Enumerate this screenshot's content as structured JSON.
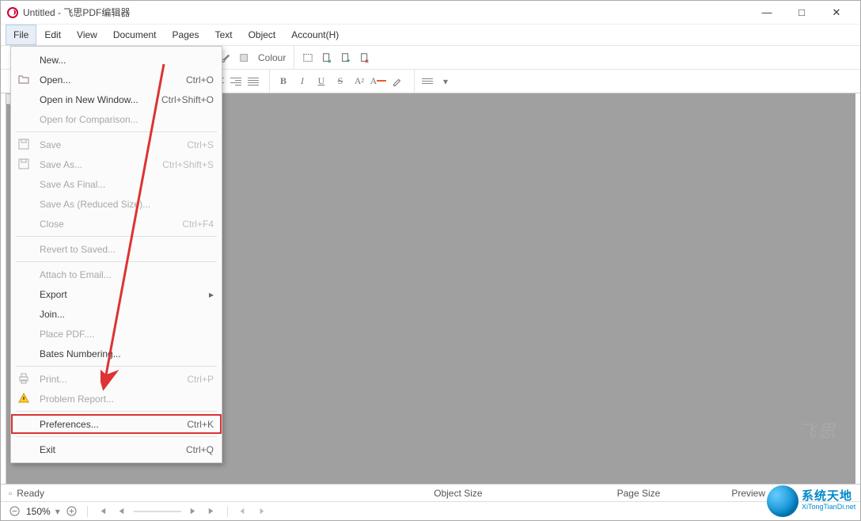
{
  "title": "Untitled - 飞思PDF编辑器",
  "window_controls": {
    "min": "—",
    "max": "□",
    "close": "✕"
  },
  "menubar": [
    "File",
    "Edit",
    "View",
    "Document",
    "Pages",
    "Text",
    "Object",
    "Account(H)"
  ],
  "menubar_active_index": 0,
  "toolbar2": {
    "colour_label": "Colour"
  },
  "file_menu": [
    {
      "type": "item",
      "label": "New...",
      "shortcut": "",
      "icon": "",
      "disabled": false
    },
    {
      "type": "item",
      "label": "Open...",
      "shortcut": "Ctrl+O",
      "icon": "folder",
      "disabled": false
    },
    {
      "type": "item",
      "label": "Open in New Window...",
      "shortcut": "Ctrl+Shift+O",
      "icon": "",
      "disabled": false
    },
    {
      "type": "item",
      "label": "Open for Comparison...",
      "shortcut": "",
      "icon": "",
      "disabled": true
    },
    {
      "type": "sep"
    },
    {
      "type": "item",
      "label": "Save",
      "shortcut": "Ctrl+S",
      "icon": "save",
      "disabled": true
    },
    {
      "type": "item",
      "label": "Save As...",
      "shortcut": "Ctrl+Shift+S",
      "icon": "save",
      "disabled": true
    },
    {
      "type": "item",
      "label": "Save As Final...",
      "shortcut": "",
      "icon": "",
      "disabled": true
    },
    {
      "type": "item",
      "label": "Save As (Reduced Size)...",
      "shortcut": "",
      "icon": "",
      "disabled": true
    },
    {
      "type": "item",
      "label": "Close",
      "shortcut": "Ctrl+F4",
      "icon": "",
      "disabled": true
    },
    {
      "type": "sep"
    },
    {
      "type": "item",
      "label": "Revert to Saved...",
      "shortcut": "",
      "icon": "",
      "disabled": true
    },
    {
      "type": "sep"
    },
    {
      "type": "item",
      "label": "Attach to Email...",
      "shortcut": "",
      "icon": "",
      "disabled": true
    },
    {
      "type": "item",
      "label": "Export",
      "shortcut": "",
      "icon": "",
      "disabled": false,
      "submenu": true
    },
    {
      "type": "item",
      "label": "Join...",
      "shortcut": "",
      "icon": "",
      "disabled": false
    },
    {
      "type": "item",
      "label": "Place PDF....",
      "shortcut": "",
      "icon": "",
      "disabled": true
    },
    {
      "type": "item",
      "label": "Bates Numbering...",
      "shortcut": "",
      "icon": "",
      "disabled": false
    },
    {
      "type": "sep"
    },
    {
      "type": "item",
      "label": "Print...",
      "shortcut": "Ctrl+P",
      "icon": "print",
      "disabled": true
    },
    {
      "type": "item",
      "label": "Problem Report...",
      "shortcut": "",
      "icon": "warn",
      "disabled": true
    },
    {
      "type": "sep"
    },
    {
      "type": "item",
      "label": "Preferences...",
      "shortcut": "Ctrl+K",
      "icon": "",
      "disabled": false,
      "highlight": true
    },
    {
      "type": "sep"
    },
    {
      "type": "item",
      "label": "Exit",
      "shortcut": "Ctrl+Q",
      "icon": "",
      "disabled": false
    }
  ],
  "status": {
    "ready": "Ready",
    "object_size": "Object Size",
    "page_size": "Page Size",
    "preview": "Preview"
  },
  "zoom": {
    "value": "150%"
  },
  "watermark": {
    "line1": "系统天地",
    "line2": "XiTongTianDi.net"
  }
}
